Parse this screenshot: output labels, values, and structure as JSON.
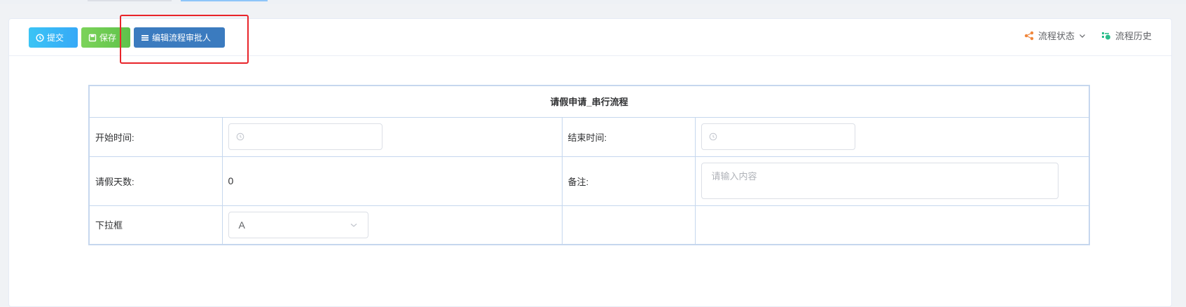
{
  "toolbar": {
    "submit_label": "提交",
    "save_label": "保存",
    "edit_approver_label": "编辑流程审批人",
    "flow_status_label": "流程状态",
    "flow_history_label": "流程历史"
  },
  "form": {
    "title": "请假申请_串行流程",
    "rows": [
      {
        "label": "开始时间:",
        "label2": "结束时间:"
      },
      {
        "label": "请假天数:",
        "value": "0",
        "label2": "备注:",
        "remark_placeholder": "请输入内容"
      },
      {
        "label": "下拉框",
        "select_value": "A"
      }
    ]
  },
  "colors": {
    "submit": "#36a9f7",
    "save": "#5fc24a",
    "edit": "#3b7bbf",
    "highlight": "#e8242a",
    "table_border": "#c6d7ee"
  }
}
